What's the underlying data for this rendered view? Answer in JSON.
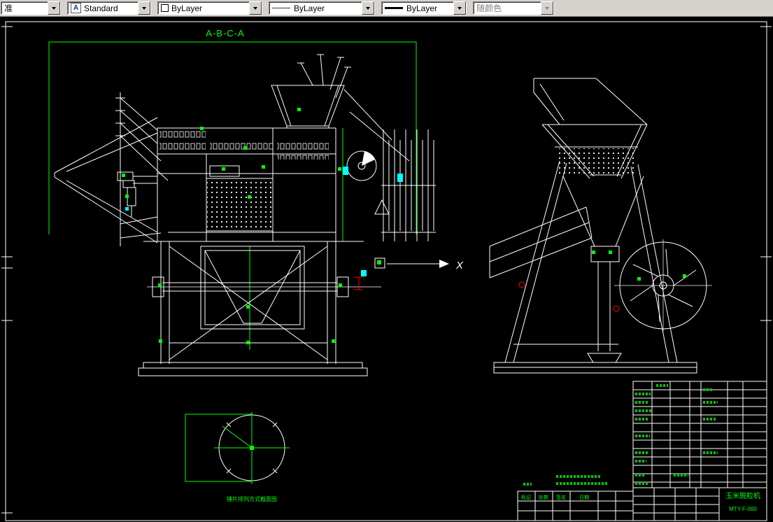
{
  "toolbar": {
    "layer_value": "准",
    "text_style_value": "Standard",
    "color_value": "ByLayer",
    "linetype_value": "ByLayer",
    "lineweight_value": "ByLayer",
    "plot_style_value": "随颜色"
  },
  "drawing": {
    "section_label": "A-B-C-A",
    "axis_label": "X",
    "detail_caption": "锤片排列方式截面图",
    "title_block": {
      "title": "玉米脱粒机",
      "drawing_no": "MTY-F-000",
      "revision_labels": [
        "标记",
        "处数",
        "签名",
        "日期"
      ]
    },
    "colors": {
      "line": "#ffffff",
      "accent": "#00ff00",
      "highlight": "#00ffff",
      "warning": "#ff0000"
    }
  }
}
